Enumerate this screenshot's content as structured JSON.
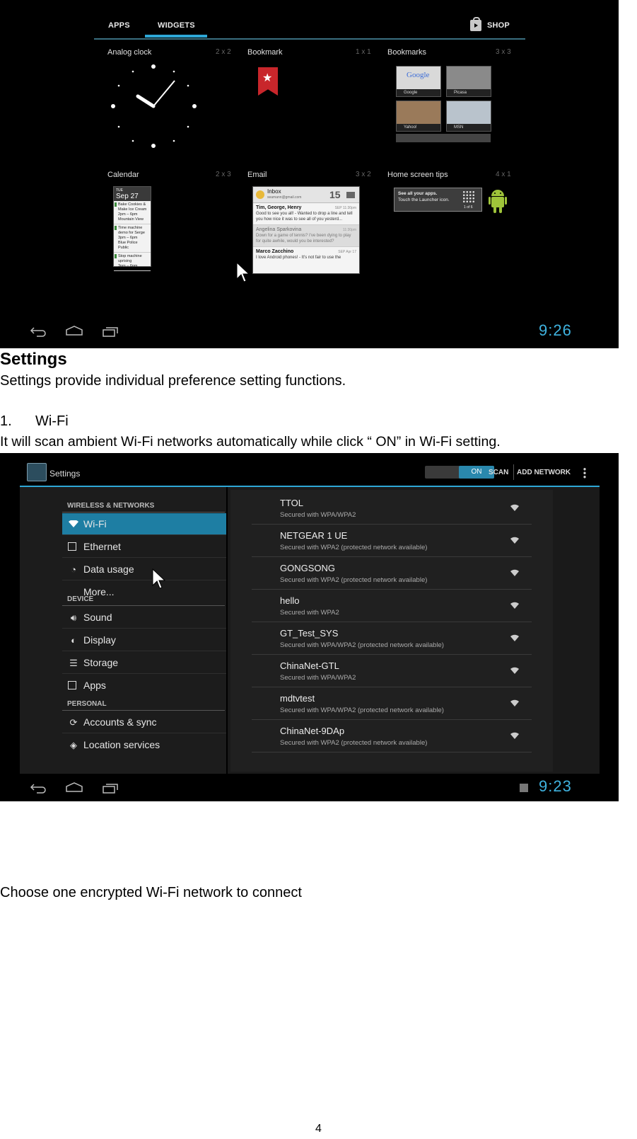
{
  "widgets_screen": {
    "tabs": [
      "APPS",
      "WIDGETS"
    ],
    "shop_label": "SHOP",
    "widgets": [
      {
        "name": "Analog clock",
        "size": "2 x 2"
      },
      {
        "name": "Bookmark",
        "size": "1 x 1"
      },
      {
        "name": "Bookmarks",
        "size": "3 x 3"
      },
      {
        "name": "Calendar",
        "size": "2 x 3"
      },
      {
        "name": "Email",
        "size": "3 x 2"
      },
      {
        "name": "Home screen tips",
        "size": "4 x 1"
      }
    ],
    "bookmark_thumbs": [
      "Google",
      "Picasa",
      "Yahoo!",
      "MSN"
    ],
    "google_logo": "Google",
    "calendar": {
      "day": "TUE",
      "date": "Sep 27",
      "events": [
        {
          "title": "Bake Cookies & Make Ice Cream",
          "time": "2pm – 6pm",
          "place": "Mountain View"
        },
        {
          "title": "Time machine demo for Serge",
          "time": "3pm – 6pm",
          "place": "Blue Police Public"
        },
        {
          "title": "Stop machine uprising",
          "time": "3pm – 6pm",
          "place": ""
        }
      ]
    },
    "email": {
      "folder": "Inbox",
      "account": "seamann@gmail.com",
      "count": "15",
      "messages": [
        {
          "from": "Tim, George, Henry",
          "date": "SEP 11:30pm",
          "preview": "Good to see you all! - Wanted to drop a line and tell you how nice it was to see all of you yesterd..."
        },
        {
          "from": "Angelina Sparkovina",
          "date": "11:30pm",
          "preview": "Down for a game of tennis? I've been dying to play for quite awhile, would you be interested?"
        },
        {
          "from": "Marco Zacchino",
          "date": "SEP Apr 17",
          "preview": "I love Android phones! - It's not fair to use the"
        }
      ]
    },
    "tip": {
      "line1": "See all your apps.",
      "line2": "Touch the Launcher icon.",
      "page": "1 of 6"
    },
    "time": "9:26"
  },
  "doc": {
    "heading": "Settings",
    "intro": "Settings provide individual preference setting functions.",
    "item_number": "1.",
    "item_title": "Wi-Fi",
    "item_desc": "It will scan ambient Wi-Fi networks automatically while click “ ON” in Wi-Fi setting.",
    "footer_text": "Choose one encrypted Wi-Fi network to connect",
    "page_number": "4"
  },
  "settings_screen": {
    "title": "Settings",
    "toggle_label": "ON",
    "scan_label": "SCAN",
    "add_network_label": "ADD NETWORK",
    "sections": {
      "wireless": "WIRELESS & NETWORKS",
      "device": "DEVICE",
      "personal": "PERSONAL"
    },
    "menu": {
      "wifi": "Wi-Fi",
      "ethernet": "Ethernet",
      "data_usage": "Data usage",
      "more": "More...",
      "sound": "Sound",
      "display": "Display",
      "storage": "Storage",
      "apps": "Apps",
      "accounts": "Accounts & sync",
      "location": "Location services"
    },
    "networks": [
      {
        "ssid": "TTOL",
        "security": "Secured with WPA/WPA2"
      },
      {
        "ssid": "NETGEAR 1 UE",
        "security": "Secured with WPA2 (protected network available)"
      },
      {
        "ssid": "GONGSONG",
        "security": "Secured with WPA2 (protected network available)"
      },
      {
        "ssid": "hello",
        "security": "Secured with WPA2"
      },
      {
        "ssid": "GT_Test_SYS",
        "security": "Secured with WPA/WPA2 (protected network available)"
      },
      {
        "ssid": "ChinaNet-GTL",
        "security": "Secured with WPA/WPA2"
      },
      {
        "ssid": "mdtvtest",
        "security": "Secured with WPA/WPA2 (protected network available)"
      },
      {
        "ssid": "ChinaNet-9DAp",
        "security": "Secured with WPA2 (protected network available)"
      }
    ],
    "time": "9:23"
  },
  "colors": {
    "accent": "#2ea7d6",
    "selected": "#1e7ea3",
    "clock_text": "#3fb3e0",
    "bookmark_red": "#c8262b",
    "android_green": "#9fc43a"
  }
}
